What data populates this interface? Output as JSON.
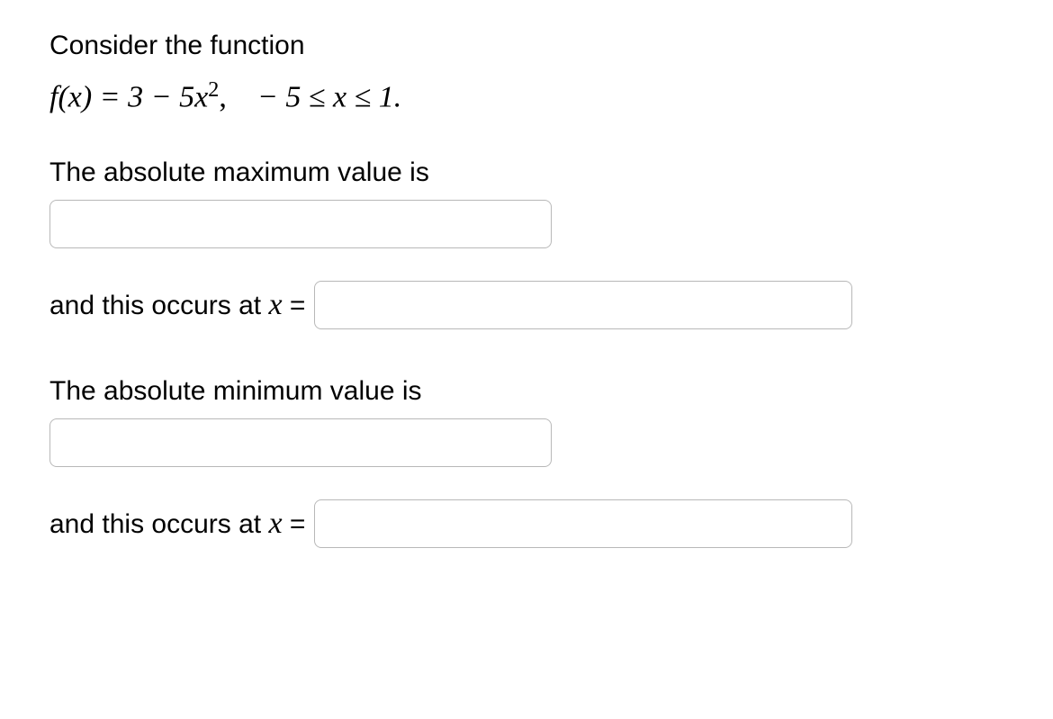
{
  "problem": {
    "intro": "Consider the function",
    "func_left": "f(x) = 3 − 5x",
    "func_exp": "2",
    "func_comma": ",",
    "domain": " − 5 ≤ x ≤ 1.",
    "max_prompt": "The absolute maximum value is",
    "occurs_at_prefix": "and this occurs at ",
    "occurs_var": "x",
    "equals": " = ",
    "min_prompt": "The absolute minimum value is"
  }
}
